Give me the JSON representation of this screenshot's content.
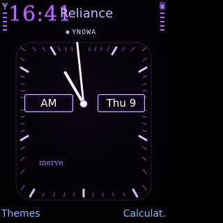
{
  "status": {
    "time": "16:41",
    "operator": "Reliance",
    "profile_icon": "bluetooth-icon",
    "profile_text": "YNOWA"
  },
  "clock": {
    "ampm": "AM",
    "date": "Thu 9",
    "brand": "merve",
    "hour": 10,
    "minute": 59
  },
  "softkeys": {
    "left": "Themes",
    "right": "Calculat."
  },
  "colors": {
    "accent": "#b46cf0",
    "tick": "#c9a4ff",
    "softkey": "#8fb4ff"
  }
}
